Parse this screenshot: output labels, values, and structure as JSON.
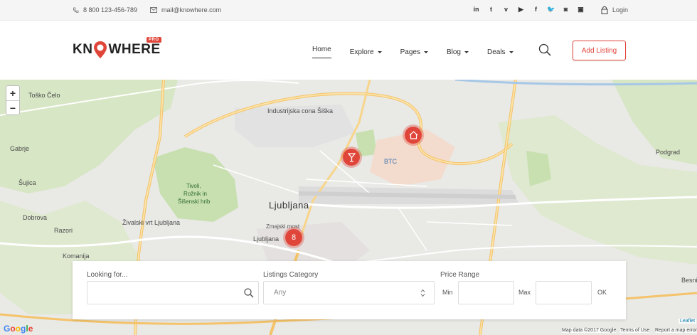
{
  "topbar": {
    "phone": "8 800 123-456-789",
    "email": "mail@knowhere.com",
    "social": [
      "in",
      "t",
      "v",
      "▶",
      "f",
      "🐦",
      "◙",
      "▣"
    ],
    "login": "Login"
  },
  "header": {
    "logo_left": "KN",
    "logo_right": "WHERE",
    "logo_badge": "PRO",
    "nav": [
      "Home",
      "Explore",
      "Pages",
      "Blog",
      "Deals"
    ],
    "add_listing": "Add Listing"
  },
  "map": {
    "zoom_in": "+",
    "zoom_out": "−",
    "marker_cluster": "8",
    "labels": {
      "industrijska": "Industrijska cona Šiška",
      "btc": "BTC",
      "ljubljana_city": "Ljubljana",
      "tivoli_1": "Tivoli,",
      "tivoli_2": "Rožnik in",
      "tivoli_3": "Šišenski hrib",
      "zoo": "Živalski vrt Ljubljana",
      "ljubljana_small": "Ljubljana",
      "zmajski": "Zmajski most",
      "tosko": "Toško Čelo",
      "gabrje": "Gabrje",
      "sujica": "Šujica",
      "dobrova": "Dobrova",
      "razori": "Razori",
      "komanija": "Komanija",
      "podgrad": "Podgrad",
      "besni": "Besni"
    },
    "google": "Google",
    "leaflet": "Leaflet",
    "attrib_data": "Map data ©2017 Google",
    "attrib_terms": "Terms of Use",
    "attrib_report": "Report a map error"
  },
  "filter": {
    "looking_label": "Looking for...",
    "looking_value": "",
    "category_label": "Listings Category",
    "category_value": "Any",
    "price_label": "Price Range",
    "min_label": "Min",
    "max_label": "Max",
    "ok_label": "OK"
  },
  "colors": {
    "accent": "#e0453a"
  }
}
